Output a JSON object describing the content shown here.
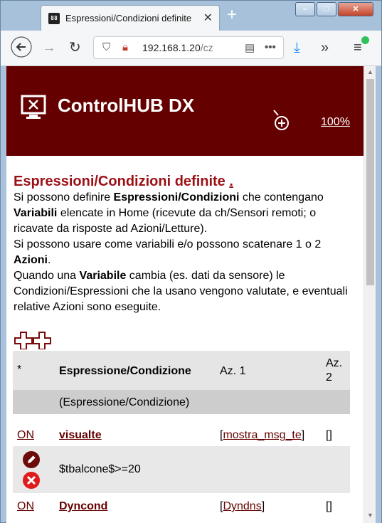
{
  "browser": {
    "tab_title": "Espressioni/Condizioni definite",
    "tab_favicon": "88",
    "url_host": "192.168.1.20",
    "url_path": "/cz"
  },
  "header": {
    "brand": "ControlHUB DX",
    "zoom": "100%"
  },
  "page": {
    "title": "Espressioni/Condizioni definite",
    "title_suffix": ".",
    "intro": {
      "t1": "Si possono definire ",
      "b1": "Espressioni/Condizioni",
      "t2": " che contengano ",
      "b2": "Variabili",
      "t3": " elencate in Home (ricevute da ch/Sensori remoti; o ricavate da risposte ad Azioni/Letture).",
      "t4": "Si possono usare come variabili e/o possono scatenare 1 o 2 ",
      "b3": "Azioni",
      "t5": ".",
      "t6": "Quando una ",
      "b4": "Variabile",
      "t7": " cambia (es. dati da sensore) le Condizioni/Espressioni che la usano vengono valutate, e eventuali relative Azioni sono eseguite."
    }
  },
  "table": {
    "headers": {
      "star": "*",
      "expression": "Espressione/Condizione",
      "az1": "Az. 1",
      "az2": "Az. 2"
    },
    "subheader": "(Espressione/Condizione)",
    "rows": [
      {
        "status": "ON",
        "name": "visualte",
        "az1_open": "[",
        "az1": "mostra_msg_te",
        "az1_close": "]",
        "az2": "[]",
        "expression": "$tbalcone$>=20"
      },
      {
        "status": "ON",
        "name": "Dyncond",
        "az1_open": "[",
        "az1": "Dyndns",
        "az1_close": "]",
        "az2": "[]"
      }
    ]
  },
  "colors": {
    "banner": "#650000",
    "heading": "#9b1015"
  },
  "icons": [
    "monitor-logo-icon",
    "zoom-in-icon",
    "add-icon",
    "edit-icon",
    "delete-icon"
  ]
}
